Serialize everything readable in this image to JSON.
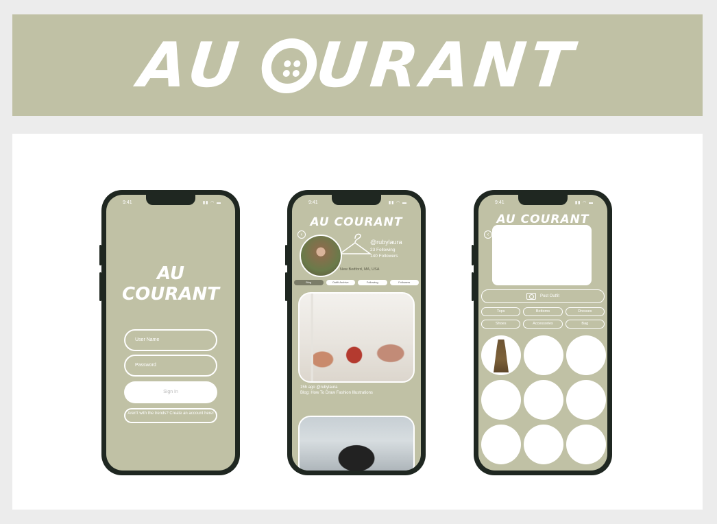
{
  "banner": {
    "brand": "AU COURANT"
  },
  "phones": {
    "status_time": "9:41",
    "status_icons": "▮▮ ◠ ▬",
    "login": {
      "logo_line1": "AU",
      "logo_line2": "COURANT",
      "username_placeholder": "User Name",
      "password_placeholder": "Password",
      "signin_label": "Sign In",
      "create_account": "Aren't with the trends? Create an account here!"
    },
    "profile": {
      "brand": "AU COURANT",
      "handle": "@rubylaura",
      "following": "23   Following",
      "followers": "140 Followers",
      "location": "New Bedford, MA, USA",
      "tabs": [
        "Blog",
        "Outfit Archive",
        "Following",
        "Followers"
      ],
      "post_meta": "15h ago    @rubylaura",
      "post_caption": "Blog: How To Draw Fashion Illustrations"
    },
    "closet": {
      "brand": "AU COURANT",
      "post_outfit_label": "Post Outfit",
      "categories_row1": [
        "Tops",
        "Bottoms",
        "Dresses"
      ],
      "categories_row2": [
        "Shoes",
        "Accessories",
        "Bag"
      ]
    }
  },
  "colors": {
    "sage": "#c0c1a5",
    "frame": "#1f2721"
  }
}
